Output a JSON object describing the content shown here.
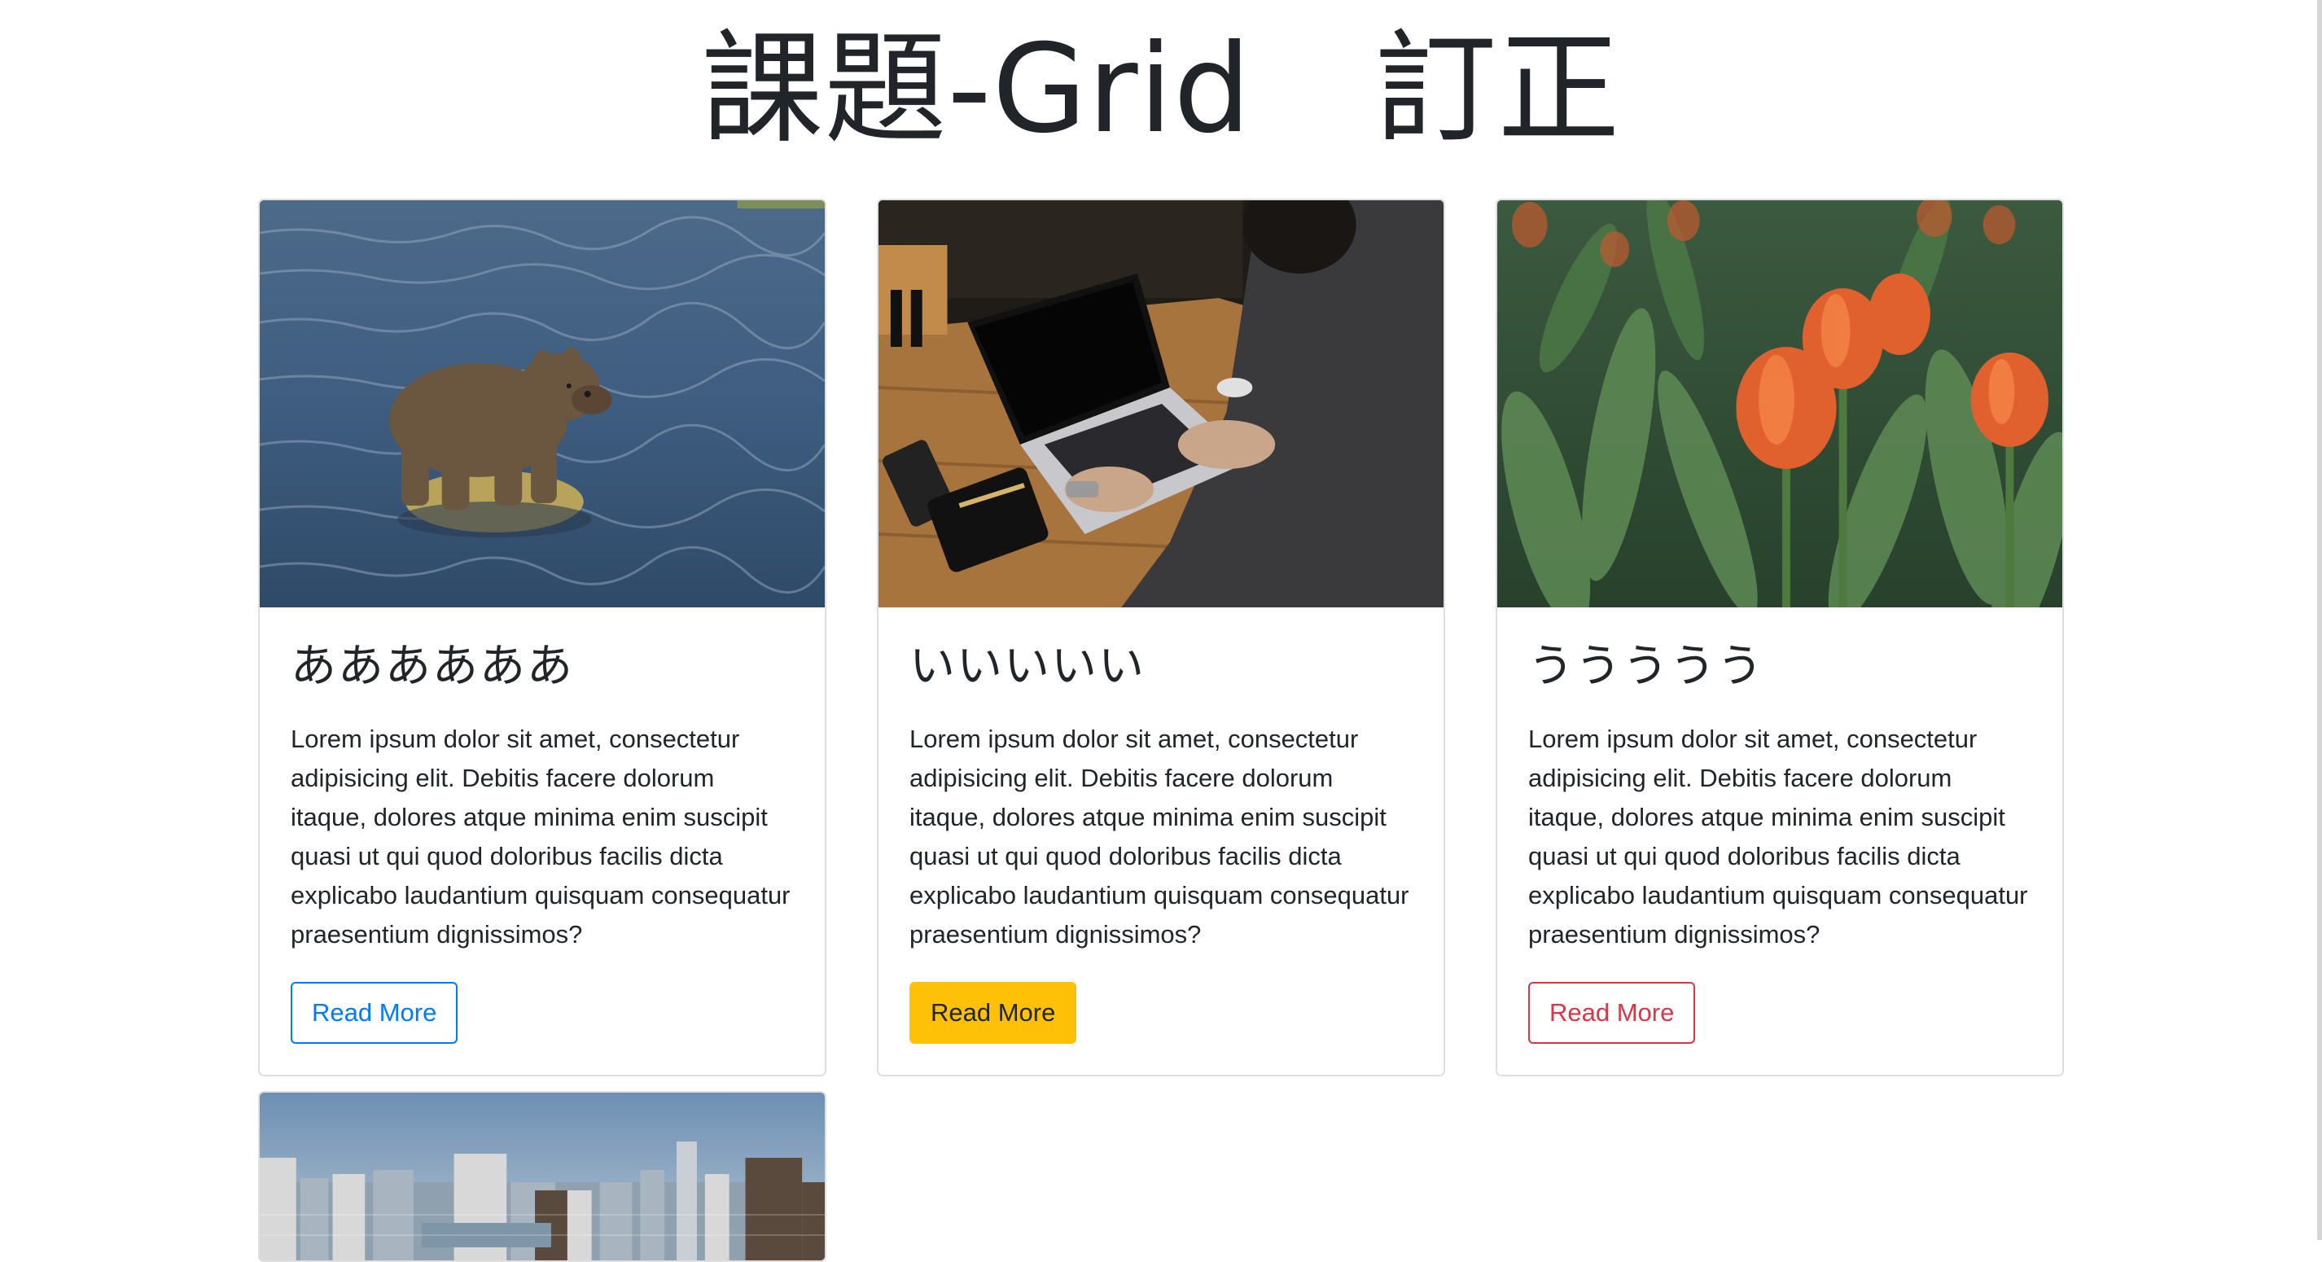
{
  "page": {
    "title": "課題-Grid　訂正"
  },
  "cards": [
    {
      "title": "ああああああ",
      "text": "Lorem ipsum dolor sit amet, consectetur adipisicing elit. Debitis facere dolorum itaque, dolores atque minima enim suscipit quasi ut qui quod doloribus facilis dicta explicabo laudantium quisquam consequatur praesentium dignissimos?",
      "button_label": "Read More",
      "image": "bear-on-rock-in-river",
      "button_style": "outline-primary",
      "button_color": "#007bff"
    },
    {
      "title": "いいいいい",
      "text": "Lorem ipsum dolor sit amet, consectetur adipisicing elit. Debitis facere dolorum itaque, dolores atque minima enim suscipit quasi ut qui quod doloribus facilis dicta explicabo laudantium quisquam consequatur praesentium dignissimos?",
      "button_label": "Read More",
      "image": "person-typing-on-laptop",
      "button_style": "warning",
      "button_color": "#ffc107"
    },
    {
      "title": "ううううう",
      "text": "Lorem ipsum dolor sit amet, consectetur adipisicing elit. Debitis facere dolorum itaque, dolores atque minima enim suscipit quasi ut qui quod doloribus facilis dicta explicabo laudantium quisquam consequatur praesentium dignissimos?",
      "button_label": "Read More",
      "image": "orange-tulips",
      "button_style": "outline-danger",
      "button_color": "#dc3545"
    },
    {
      "image": "city-skyline"
    }
  ]
}
